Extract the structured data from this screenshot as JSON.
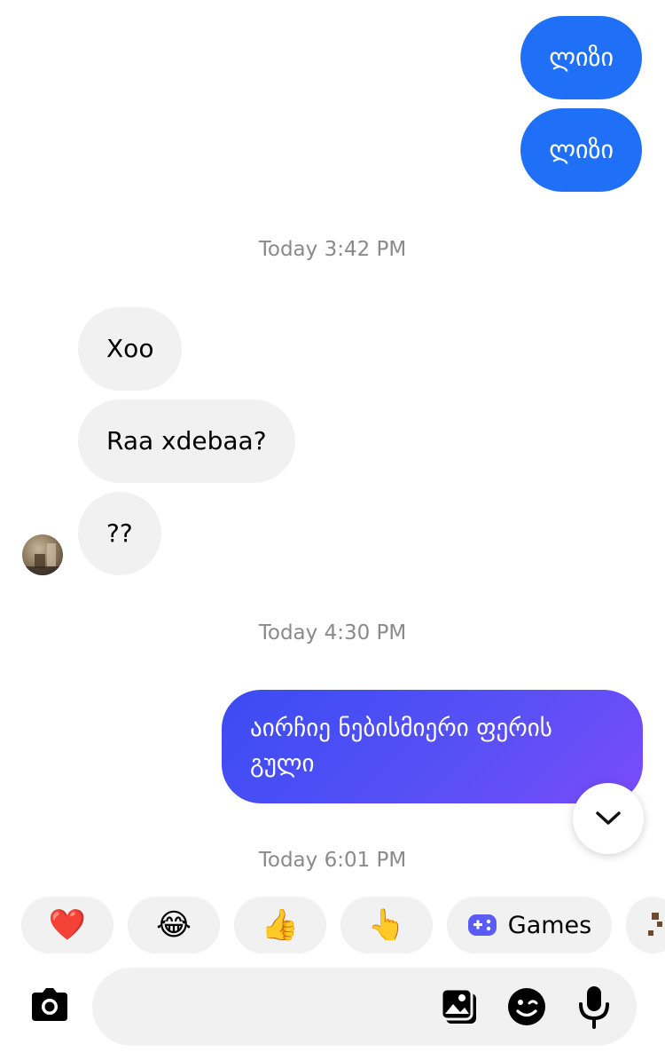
{
  "messages": {
    "out_1": "ლიზი",
    "out_2": "ლიზი",
    "ts_1": "Today 3:42 PM",
    "in_1": "Xoo",
    "in_2": "Raa xdebaa?",
    "in_3": "??",
    "ts_2": "Today 4:30 PM",
    "out_3": "აირჩიე ნებისმიერი ფერის გული",
    "ts_3": "Today 6:01 PM"
  },
  "quick_reactions": [
    {
      "icon": "heart-emoji",
      "glyph": "❤️"
    },
    {
      "icon": "tears-of-joy-emoji",
      "glyph": "😂"
    },
    {
      "icon": "thumbs-up-emoji",
      "glyph": "👍"
    },
    {
      "icon": "pointing-up-emoji",
      "glyph": "👆"
    }
  ],
  "games_chip": {
    "label": "Games",
    "icon": "gamepad-icon"
  },
  "composer": {
    "camera_icon": "camera-icon",
    "gallery_icon": "gallery-icon",
    "sticker_icon": "sticker-icon",
    "mic_icon": "microphone-icon"
  },
  "colors": {
    "outgoing": "#1f70f7",
    "gradient_start": "#3a4cf2",
    "gradient_end": "#7a4cf8",
    "incoming": "#f1f1f1",
    "games": "#5b5bf5"
  }
}
